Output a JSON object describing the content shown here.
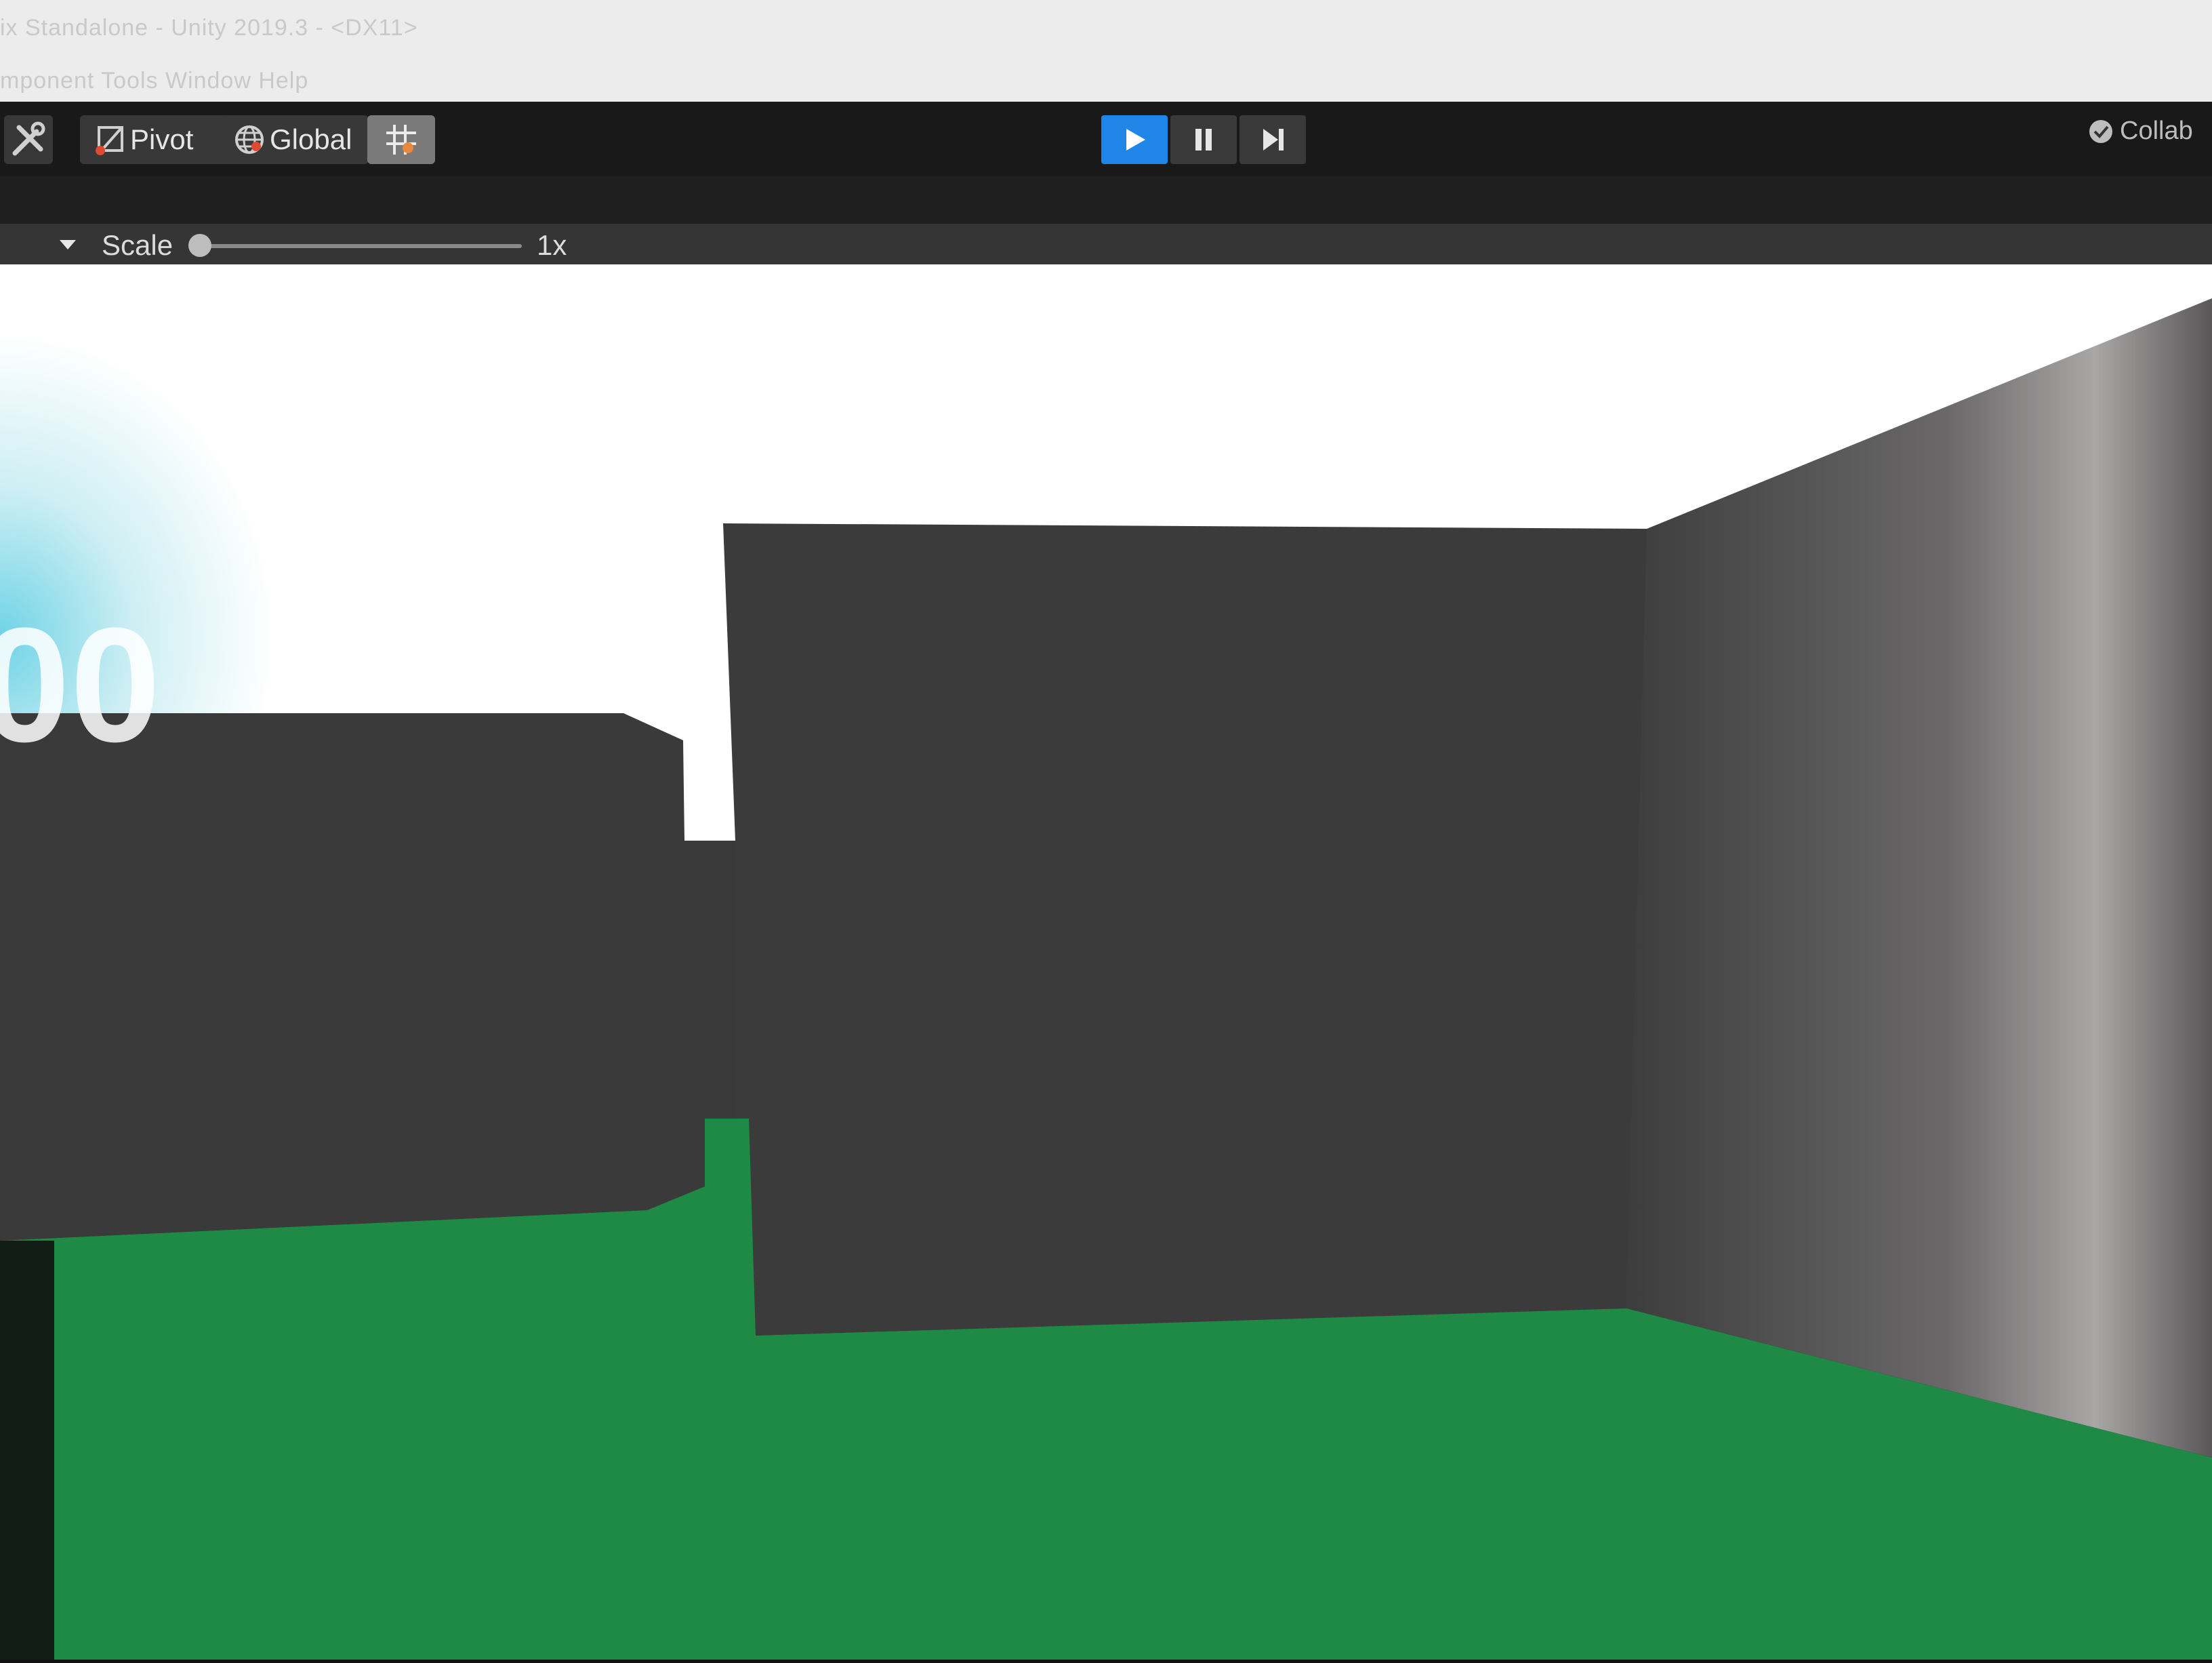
{
  "window": {
    "title": "ix Standalone - Unity 2019.3 - <DX11>",
    "menu": "mponent   Tools   Window   Help"
  },
  "toolbar": {
    "pivot_label": "Pivot",
    "global_label": "Global",
    "collab_label": "Collab",
    "play_active": true
  },
  "game_view": {
    "scale_label": "Scale",
    "scale_value": "1x",
    "scale_slider_fraction": 0.0
  },
  "scene": {
    "score_text": "00",
    "colors": {
      "sky": "#ffffff",
      "wall": "#3b3b3b",
      "floor": "#1f8a45",
      "play_button": "#1f86e8"
    }
  }
}
